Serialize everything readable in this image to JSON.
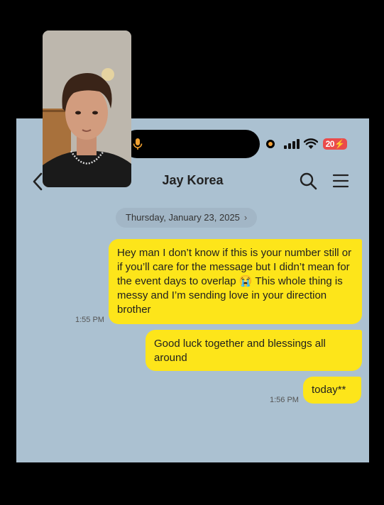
{
  "status_bar": {
    "battery": "20"
  },
  "header": {
    "contact_name": "Jay Korea"
  },
  "chat": {
    "date": "Thursday, January 23, 2025",
    "messages": [
      {
        "text": "Hey man I don’t know if this is your number still or if you’ll care for the message but I didn’t mean for the event days to overlap 😭 This whole thing is messy and I’m sending love in your direction brother"
      },
      {
        "text": "Good luck together and blessings all around"
      },
      {
        "text": "today**"
      }
    ],
    "times": [
      "1:55 PM",
      "1:56 PM"
    ]
  },
  "colors": {
    "background": "#abc1d1",
    "bubble": "#fde51a",
    "battery": "#ea4b4b"
  }
}
